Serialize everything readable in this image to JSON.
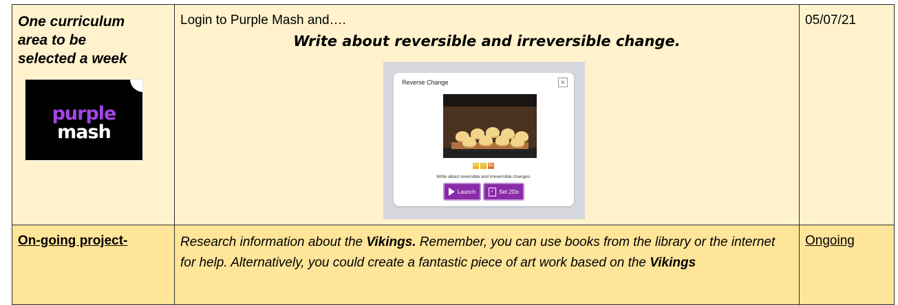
{
  "row1": {
    "subject_lines": [
      "One curriculum",
      "area to be",
      "selected a week"
    ],
    "logo": {
      "line1": "purple",
      "line2": "mash"
    },
    "intro": "Login to Purple Mash and….",
    "task": "Write about reversible and irreversible change.",
    "activity_card": {
      "title": "Reverse Change",
      "close_icon": "close-icon",
      "badges": [
        {
          "text": "Ex",
          "color": "#e8b820"
        },
        {
          "text": "Lt",
          "color": "#e8b820"
        },
        {
          "text": "Bc",
          "color": "#e07828"
        }
      ],
      "description": "Write about reversible and irreversible changes.",
      "launch_label": "Launch",
      "set_label": "Set 2Do"
    },
    "date": "05/07/21"
  },
  "row2": {
    "label": "On-going project-",
    "research": {
      "part1": "Research information about the ",
      "bold1": "Vikings.",
      "part2": " Remember, you can use books from the library or the internet for help. Alternatively, you could create a fantastic piece of art work based on the ",
      "bold2": "Vikings"
    },
    "status": "Ongoing"
  },
  "colors": {
    "row1_bg": "#fff2cc",
    "row2_bg": "#ffe599",
    "brand_purple": "#8a2ba8"
  }
}
